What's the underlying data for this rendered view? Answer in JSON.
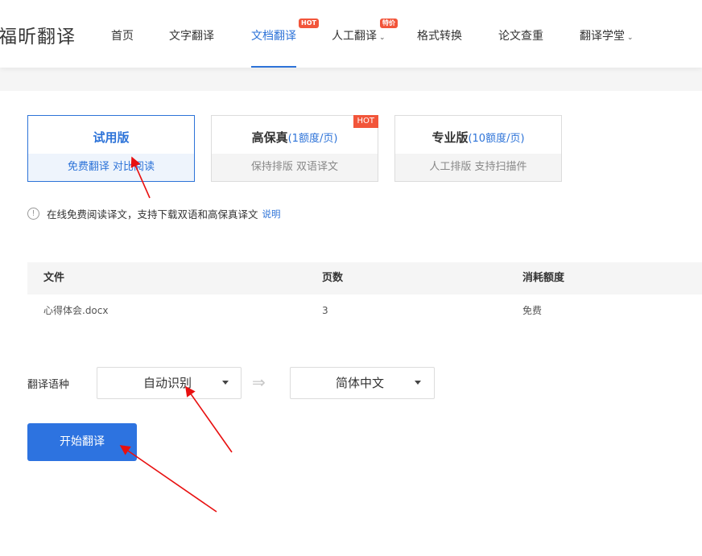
{
  "brand": {
    "logo_text": "福昕翻译"
  },
  "nav": {
    "items": [
      {
        "label": "首页"
      },
      {
        "label": "文字翻译"
      },
      {
        "label": "文档翻译",
        "badge": "HOT"
      },
      {
        "label": "人工翻译",
        "badge": "特价"
      },
      {
        "label": "格式转换"
      },
      {
        "label": "论文查重"
      },
      {
        "label": "翻译学堂"
      }
    ],
    "active": "文档翻译"
  },
  "versions": [
    {
      "title": "试用版",
      "note": "",
      "subtitle": "免费翻译  对比阅读",
      "selected": true
    },
    {
      "title": "高保真",
      "note": "(1额度/页)",
      "subtitle": "保持排版  双语译文",
      "badge": "HOT"
    },
    {
      "title": "专业版",
      "note": "(10额度/页)",
      "subtitle": "人工排版  支持扫描件"
    }
  ],
  "info": {
    "icon": "!",
    "text": "在线免费阅读译文，支持下载双语和高保真译文",
    "link": "说明"
  },
  "table": {
    "headers": [
      "文件",
      "页数",
      "消耗额度"
    ],
    "rows": [
      [
        "心得体会.docx",
        "3",
        "免费"
      ]
    ]
  },
  "language": {
    "label": "翻译语种",
    "source": "自动识别",
    "swap_icon": "⇒",
    "target": "简体中文"
  },
  "start_button": "开始翻译",
  "colors": {
    "accent": "#2d73d8",
    "hot": "#f2553a",
    "annotation": "#e81010"
  }
}
